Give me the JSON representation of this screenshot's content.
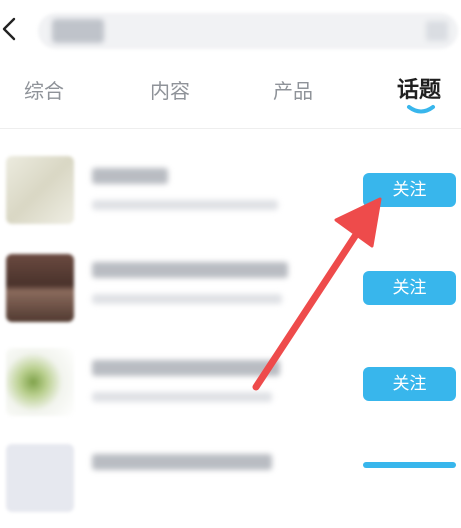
{
  "header": {
    "back_icon": "chevron-left-icon"
  },
  "tabs": [
    {
      "label": "综合",
      "active": false
    },
    {
      "label": "内容",
      "active": false
    },
    {
      "label": "产品",
      "active": false
    },
    {
      "label": "话题",
      "active": true
    }
  ],
  "list": {
    "items": [
      {
        "follow_label": "关注"
      },
      {
        "follow_label": "关注"
      },
      {
        "follow_label": "关注"
      }
    ]
  },
  "colors": {
    "accent": "#38b6ec",
    "arrow": "#ee4b4b",
    "tab_inactive": "#8f9399",
    "tab_active": "#1f1f1f"
  }
}
